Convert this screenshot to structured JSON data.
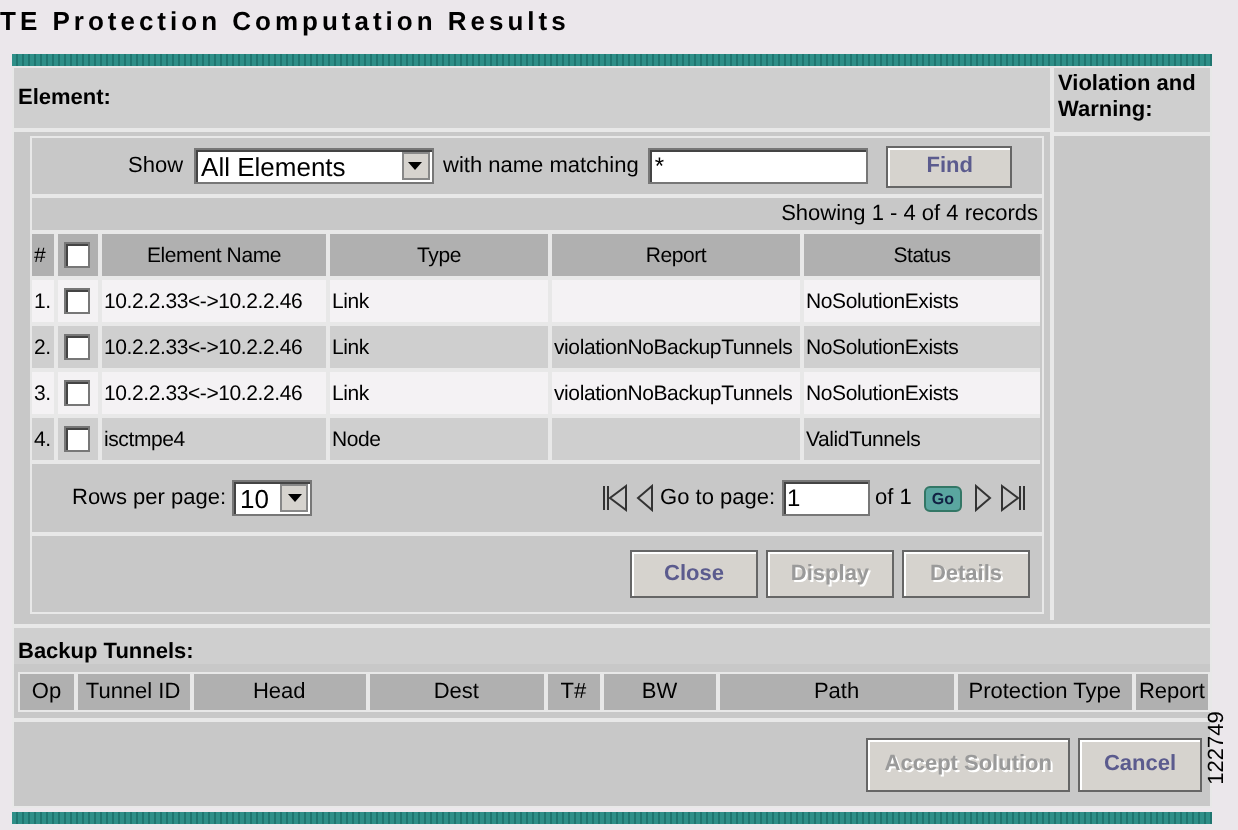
{
  "title": "TE Protection Computation Results",
  "element_panel": {
    "label": "Element:",
    "filter": {
      "show_label": "Show",
      "show_value": "All Elements",
      "match_label": "with name matching",
      "match_value": "*",
      "find_button": {
        "label": "Find",
        "disabled": false
      }
    },
    "record_count": "Showing 1 - 4 of 4 records",
    "select_all_checked": false,
    "columns": [
      "#",
      "Element Name",
      "Type",
      "Report",
      "Status"
    ],
    "rows": [
      {
        "index": "1.",
        "checked": false,
        "name": "10.2.2.33<->10.2.2.46",
        "type": "Link",
        "report": "",
        "status": "NoSolutionExists"
      },
      {
        "index": "2.",
        "checked": false,
        "name": "10.2.2.33<->10.2.2.46",
        "type": "Link",
        "report": "violationNoBackupTunnels",
        "status": "NoSolutionExists"
      },
      {
        "index": "3.",
        "checked": false,
        "name": "10.2.2.33<->10.2.2.46",
        "type": "Link",
        "report": "violationNoBackupTunnels",
        "status": "NoSolutionExists"
      },
      {
        "index": "4.",
        "checked": false,
        "name": "isctmpe4",
        "type": "Node",
        "report": "",
        "status": "ValidTunnels"
      }
    ],
    "pagination": {
      "rows_label": "Rows per page:",
      "rows_value": "10",
      "goto_label": "Go to page:",
      "page_value": "1",
      "of_label": "of 1",
      "go_button": "Go"
    },
    "buttons": [
      {
        "label": "Close",
        "disabled": false
      },
      {
        "label": "Display",
        "disabled": true
      },
      {
        "label": "Details",
        "disabled": true
      }
    ]
  },
  "violation_panel": {
    "label": "Violation and Warning:"
  },
  "backup_tunnels": {
    "label": "Backup Tunnels:",
    "columns": [
      "Op",
      "Tunnel ID",
      "Head",
      "Dest",
      "T#",
      "BW",
      "Path",
      "Protection Type",
      "Report"
    ]
  },
  "buttons": [
    {
      "label": "Accept Solution",
      "disabled": true
    },
    {
      "label": "Cancel",
      "disabled": false
    }
  ],
  "figure_number": "122749"
}
